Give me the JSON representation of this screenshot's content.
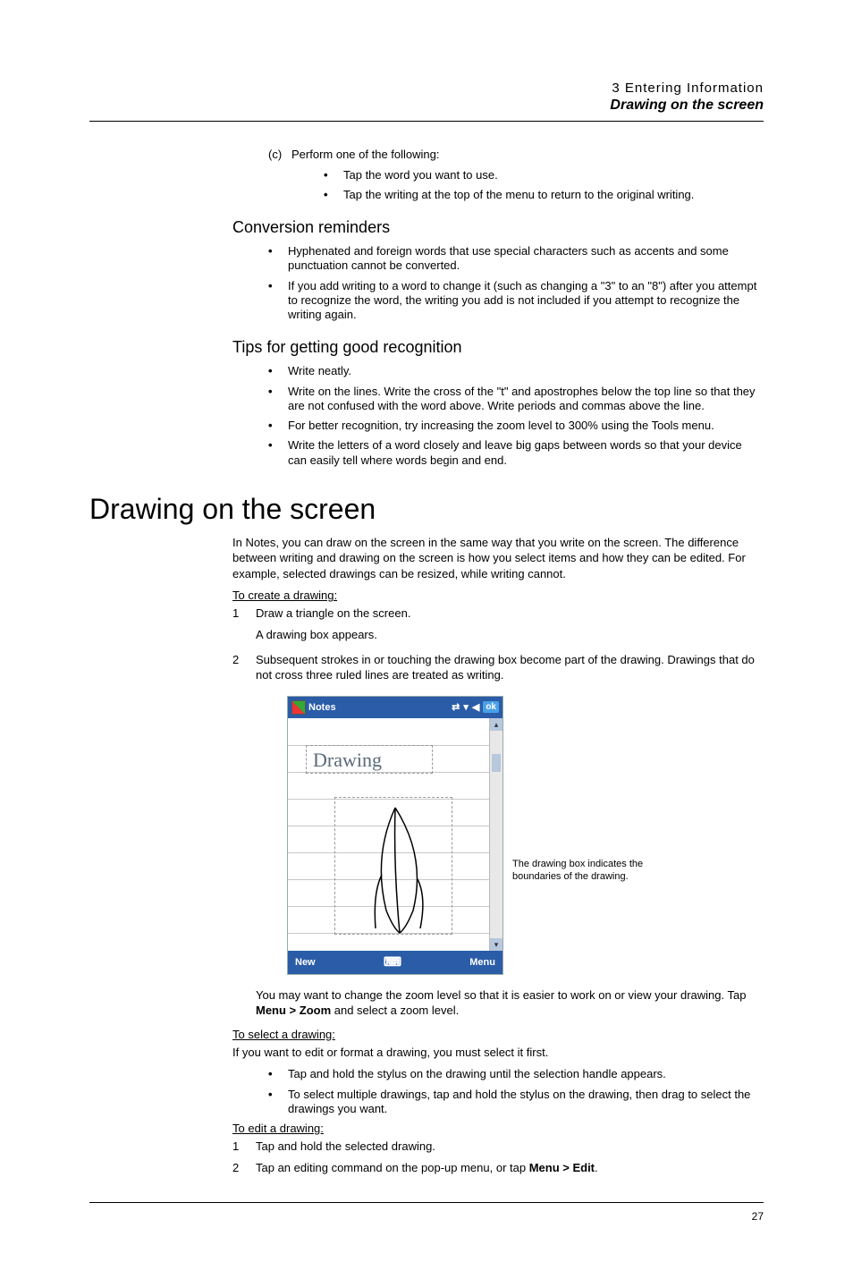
{
  "header": {
    "chapter": "3 Entering Information",
    "sub": "Drawing on the screen"
  },
  "intro": {
    "c_label": "(c)",
    "c_text": "Perform one of the following:",
    "c_b1": "Tap the word you want to use.",
    "c_b2": "Tap the writing at the top of the menu to return to the original writing."
  },
  "conv": {
    "h": "Conversion reminders",
    "b1": "Hyphenated and foreign words that use special characters such as accents and some punctuation cannot be converted.",
    "b2": "If you add writing to a word to change it (such as changing a \"3\" to an \"8\") after you attempt to recognize the word, the writing you add is not included if you attempt to recognize the writing again."
  },
  "tips": {
    "h": "Tips for getting good recognition",
    "b1": "Write neatly.",
    "b2": "Write on the lines. Write the cross of the \"t\" and apostrophes below the top line so that they are not confused with the word above. Write periods and commas above the line.",
    "b3": "For better recognition, try increasing the zoom level to 300% using the Tools menu.",
    "b4": "Write the letters of a word closely and leave big gaps between words so that your device can easily tell where words begin and end."
  },
  "draw": {
    "h": "Drawing on the screen",
    "p1": "In Notes, you can draw on the screen in the same way that you write on the screen. The difference between writing and drawing on the screen is how you select items and how they can be edited. For example, selected drawings can be resized, while writing cannot.",
    "create_h": "To create a drawing:",
    "s1": "Draw a triangle on the screen.",
    "s1b": "A drawing box appears.",
    "s2": "Subsequent strokes in or touching the drawing box become part of the drawing. Drawings that do not cross three ruled lines are treated as writing.",
    "device": {
      "title": "Notes",
      "ok": "ok",
      "handwriting": "Drawing",
      "new": "New",
      "menu": "Menu"
    },
    "callout": "The drawing box indicates the boundaries of the drawing.",
    "after": "You may want to change the zoom level so that it is easier to work on or view your drawing. Tap ",
    "after_b": "Menu > Zoom",
    "after2": " and select a zoom level.",
    "select_h": "To select a drawing:",
    "select_p": "If you want to edit or format a drawing, you must select it first.",
    "sel_b1": "Tap and hold the stylus on the drawing until the selection handle appears.",
    "sel_b2": "To select multiple drawings, tap and hold the stylus on the drawing, then drag to select the drawings you want.",
    "edit_h": "To edit a drawing:",
    "e1": "Tap and hold the selected drawing.",
    "e2a": "Tap an editing command on the pop-up menu, or tap ",
    "e2b": "Menu > Edit",
    "e2c": "."
  },
  "pagenum": "27"
}
